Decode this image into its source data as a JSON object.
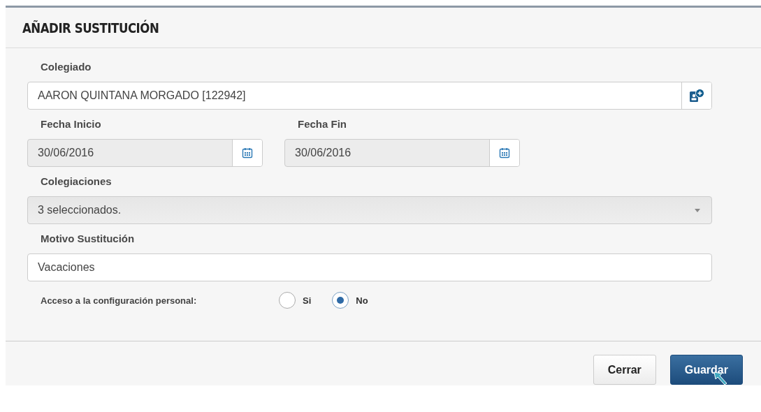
{
  "dialog": {
    "title": "AÑADIR SUSTITUCIÓN"
  },
  "colegiado": {
    "label": "Colegiado",
    "value": "AARON QUINTANA MORGADO [122942]"
  },
  "fecha_inicio": {
    "label": "Fecha Inicio",
    "value": "30/06/2016",
    "disabled": true
  },
  "fecha_fin": {
    "label": "Fecha Fin",
    "value": "30/06/2016",
    "disabled": true
  },
  "colegiaciones": {
    "label": "Colegiaciones",
    "value": "3 seleccionados.",
    "disabled": true
  },
  "motivo": {
    "label": "Motivo Sustitución",
    "value": "Vacaciones"
  },
  "acceso": {
    "label": "Acceso a la configuración personal:",
    "options": [
      {
        "label": "Si",
        "selected": false
      },
      {
        "label": "No",
        "selected": true
      }
    ]
  },
  "buttons": [
    {
      "label": "Cerrar",
      "kind": "secondary"
    },
    {
      "label": "Guardar",
      "kind": "primary"
    }
  ]
}
